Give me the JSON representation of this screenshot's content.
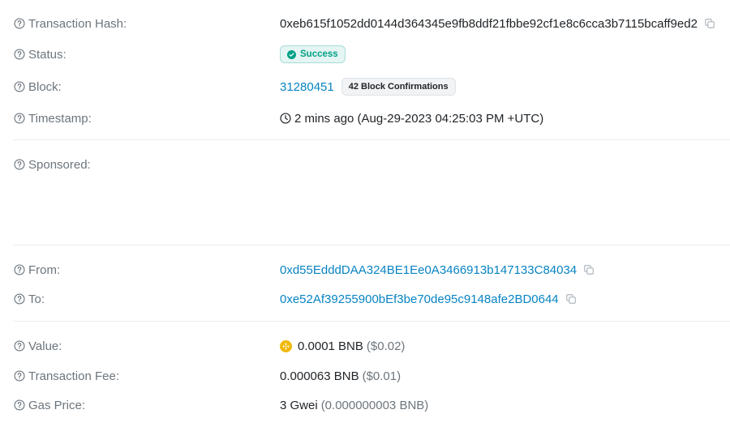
{
  "labels": {
    "hash": "Transaction Hash:",
    "status": "Status:",
    "block": "Block:",
    "timestamp": "Timestamp:",
    "sponsored": "Sponsored:",
    "from": "From:",
    "to": "To:",
    "value": "Value:",
    "fee": "Transaction Fee:",
    "gas": "Gas Price:"
  },
  "values": {
    "hash": "0xeb615f1052dd0144d364345e9fb8ddf21fbbe92cf1e8c6cca3b7115bcaff9ed2",
    "status": "Success",
    "block_number": "31280451",
    "block_confirmations": "42 Block Confirmations",
    "timestamp": "2 mins ago (Aug-29-2023 04:25:03 PM +UTC)",
    "from": "0xd55EdddDAA324BE1Ee0A3466913b147133C84034",
    "to": "0xe52Af39255900bEf3be70de95c9148afe2BD0644",
    "value_amount": "0.0001 BNB",
    "value_usd": "($0.02)",
    "fee_amount": "0.000063 BNB",
    "fee_usd": "($0.01)",
    "gas_amount": "3 Gwei",
    "gas_bnb": "(0.000000003 BNB)"
  },
  "icons": {
    "help": "question-circle-icon",
    "copy": "copy-icon",
    "check": "check-circle-icon",
    "clock": "clock-icon",
    "bnb": "bnb-token-icon"
  },
  "colors": {
    "link": "#0784c3",
    "success": "#00a186",
    "muted": "#6c757d",
    "bnb": "#f0b90b"
  }
}
